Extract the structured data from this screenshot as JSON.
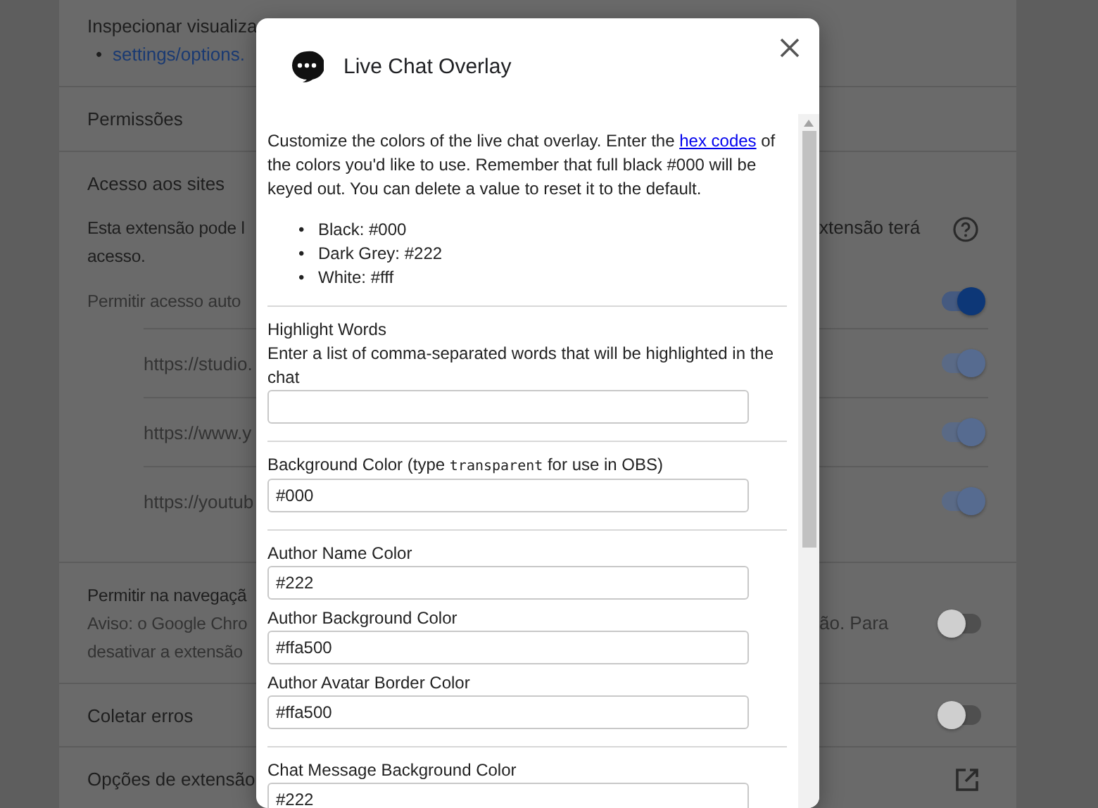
{
  "background": {
    "inspect_views": {
      "label": "Inspecionar visualiza",
      "bullet": "•",
      "links": [
        "settings/options."
      ]
    },
    "permissions": {
      "label": "Permissões"
    },
    "site_access": {
      "label": "Acesso aos sites",
      "description_left": [
        "Esta extensão pode l",
        "acesso."
      ],
      "description_right": "xtensão terá",
      "auto_access": {
        "label": "Permitir acesso auto",
        "on": true
      },
      "sites": [
        {
          "url": "https://studio.",
          "on": true,
          "disabled": true
        },
        {
          "url": "https://www.y",
          "on": true,
          "disabled": true
        },
        {
          "url": "https://youtub",
          "on": true,
          "disabled": true
        }
      ]
    },
    "incognito": {
      "label": "Permitir na navegaçã",
      "warning_left": [
        "Aviso: o Google Chro",
        "desativar a extensão"
      ],
      "warning_right": "ão. Para",
      "on": false
    },
    "collect_errors": {
      "label": "Coletar erros",
      "on": false
    },
    "extension_options": {
      "label": "Opções de extensão"
    }
  },
  "dialog": {
    "title": "Live Chat Overlay",
    "intro": {
      "before": "Customize the colors of the live chat overlay. Enter the",
      "link": "hex codes",
      "after": "of the colors you'd like to use. Remember that full black #000 will be keyed out. You can delete a value to reset it to the default."
    },
    "bullet": "•",
    "defaults": [
      "Black: #000",
      "Dark Grey: #222",
      "White: #fff"
    ],
    "groups": [
      [
        {
          "label": "Highlight Words",
          "description": "Enter a list of comma-separated words that will be highlighted in the chat"
        }
      ],
      [
        {
          "label": "Background Color (type",
          "code": "transparent",
          "label_after": "for use in OBS)",
          "value": "#000"
        }
      ],
      [
        {
          "label": "Author Name Color",
          "value": "#222"
        },
        {
          "label": "Author Background Color",
          "value": "#ffa500"
        },
        {
          "label": "Author Avatar Border Color",
          "value": "#ffa500"
        }
      ],
      [
        {
          "label": "Chat Message Background Color",
          "value": "#222"
        }
      ]
    ]
  }
}
